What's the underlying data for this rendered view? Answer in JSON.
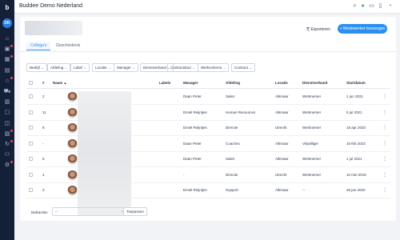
{
  "app": {
    "title": "Buddee Demo Nederland",
    "logo": "b",
    "user_initials": "DK"
  },
  "sidebar": {
    "items": [
      {
        "icon": "home-icon",
        "glyph": "⌂",
        "badge": false
      },
      {
        "icon": "inbox-icon",
        "glyph": "▣",
        "badge": true
      },
      {
        "icon": "calendar-icon",
        "glyph": "▦",
        "badge": true
      },
      {
        "icon": "document-icon",
        "glyph": "▤",
        "badge": false
      },
      {
        "icon": "star-icon",
        "glyph": "☆",
        "badge": true
      },
      {
        "icon": "car-icon",
        "glyph": "⛟",
        "badge": false
      },
      {
        "icon": "building-icon",
        "glyph": "▥",
        "badge": false
      },
      {
        "icon": "wallet-icon",
        "glyph": "▢",
        "badge": false
      },
      {
        "icon": "chart-icon",
        "glyph": "◫",
        "badge": false
      },
      {
        "icon": "file-icon",
        "glyph": "▧",
        "badge": true
      },
      {
        "icon": "refresh-icon",
        "glyph": "↻",
        "badge": true
      },
      {
        "icon": "people-icon",
        "glyph": "⚇",
        "badge": false
      },
      {
        "icon": "settings-icon",
        "glyph": "⚙",
        "badge": true
      }
    ]
  },
  "topbar": {
    "icons": [
      "search-icon",
      "status-icon",
      "chat-icon",
      "message-icon",
      "user-icon"
    ]
  },
  "header": {
    "export_label": "Exporteren",
    "add_label": "+ Medewerker toevoegen"
  },
  "tabs": [
    {
      "label": "Collega's",
      "active": true
    },
    {
      "label": "Geschiedenis",
      "active": false
    }
  ],
  "filters": [
    "Bedrijf",
    "Afdeling",
    "Label",
    "Locatie",
    "Manager",
    "Dienstverband",
    "Contractduur",
    "Werkschema",
    "Contract"
  ],
  "table": {
    "columns": {
      "num": "#",
      "name": "Naam",
      "labels": "Labels",
      "manager": "Manager",
      "afdeling": "Afdeling",
      "locatie": "Locatie",
      "dienstverband": "Dienstverband",
      "startdatum": "Startdatum"
    },
    "rows": [
      {
        "num": "2",
        "manager": "Daan Peter",
        "afdeling": "Sales",
        "locatie": "Alkmaar",
        "dienstverband": "Werknemer",
        "startdatum": "1 jun 2021"
      },
      {
        "num": "11",
        "manager": "Emiel Reijntjes",
        "afdeling": "Human Resources",
        "locatie": "Alkmaar",
        "dienstverband": "Werknemer",
        "startdatum": "5 jul 2021"
      },
      {
        "num": "8",
        "manager": "Emiel Reijntjes",
        "afdeling": "Directie",
        "locatie": "Utrecht",
        "dienstverband": "Werknemer",
        "startdatum": "18 apr 2020"
      },
      {
        "num": "-",
        "manager": "Daan Peter",
        "afdeling": "Coaches",
        "locatie": "Alkmaar",
        "dienstverband": "Vrijwilliger",
        "startdatum": "16 feb 2023"
      },
      {
        "num": "6",
        "manager": "Daan Peter",
        "afdeling": "Sales",
        "locatie": "Alkmaar",
        "dienstverband": "Werknemer",
        "startdatum": "1 jul 2021"
      },
      {
        "num": "4",
        "manager": "-",
        "afdeling": "Directie",
        "locatie": "Utrecht",
        "dienstverband": "Werknemer",
        "startdatum": "10 mei 2018"
      },
      {
        "num": "3",
        "manager": "Emiel Reijntjes",
        "afdeling": "Support",
        "locatie": "Alkmaar",
        "dienstverband": "--",
        "startdatum": "25 jan 2022"
      }
    ]
  },
  "bulk": {
    "label": "Bulkacties",
    "selected": "--",
    "apply_label": "Toepassen"
  },
  "colors": {
    "accent": "#2b8ff2",
    "sidebar": "#132038",
    "badge": "#e8445a"
  }
}
